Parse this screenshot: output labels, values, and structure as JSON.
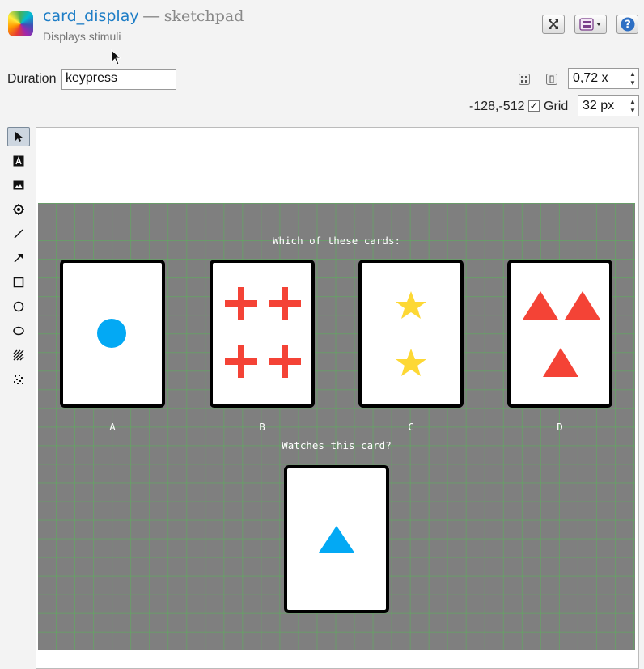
{
  "header": {
    "item_name": "card_display",
    "separator": " — ",
    "item_type": "sketchpad",
    "subtitle": "Displays stimuli"
  },
  "controls": {
    "duration_label": "Duration",
    "duration_value": "keypress",
    "zoom_value": "0,72 x",
    "cursor_position": "-128,-512",
    "grid_checkbox_mark": "✓",
    "grid_label": "Grid",
    "grid_size_value": "32 px"
  },
  "toolbar": {
    "tools": [
      "pointer-tool",
      "text-tool",
      "image-tool",
      "fixation-dot-tool",
      "line-tool",
      "arrow-tool",
      "rectangle-tool",
      "circle-tool",
      "ellipse-tool",
      "gabor-tool",
      "noise-patch-tool"
    ]
  },
  "stage": {
    "question_text": "Which of these cards:",
    "card_labels": [
      "A",
      "B",
      "C",
      "D"
    ],
    "match_text": "Watches this card?"
  },
  "colors": {
    "title_blue": "#1d7dc6",
    "stage_gray": "#7f7f7f",
    "grid_green": "#50be50",
    "shape_blue": "#03a9f4",
    "shape_red": "#f44336",
    "shape_yellow": "#fdd835"
  }
}
